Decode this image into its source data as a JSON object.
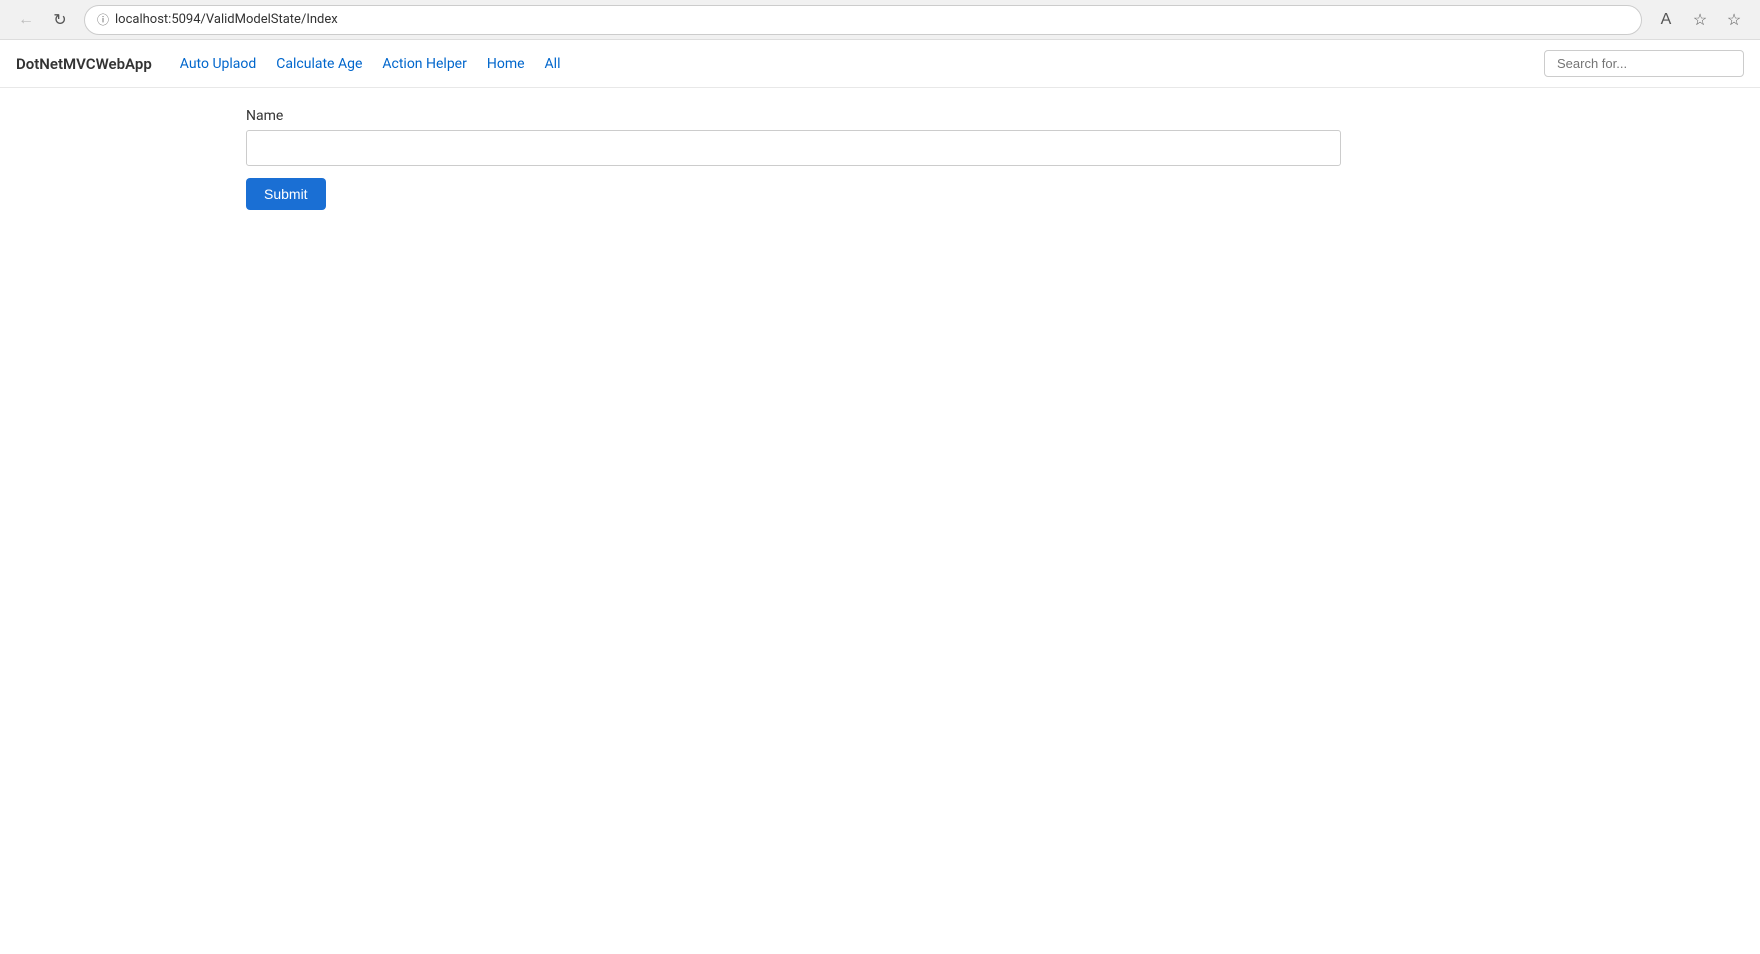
{
  "browser": {
    "url_host": "localhost:5094",
    "url_path": "/ValidModelState/Index",
    "url_display": "localhost:5094/ValidModelState/Index",
    "search_placeholder": "Search for..."
  },
  "navbar": {
    "brand": "DotNetMVCWebApp",
    "links": [
      {
        "label": "Auto Uplaod",
        "href": "#"
      },
      {
        "label": "Calculate Age",
        "href": "#"
      },
      {
        "label": "Action Helper",
        "href": "#"
      },
      {
        "label": "Home",
        "href": "#"
      },
      {
        "label": "All",
        "href": "#"
      }
    ]
  },
  "form": {
    "name_label": "Name",
    "name_placeholder": "",
    "submit_label": "Submit"
  }
}
